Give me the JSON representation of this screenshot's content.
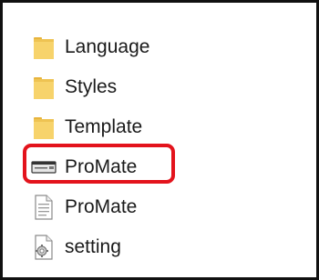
{
  "file_list": {
    "items": [
      {
        "label": "Language",
        "icon": "folder-icon"
      },
      {
        "label": "Styles",
        "icon": "folder-icon"
      },
      {
        "label": "Template",
        "icon": "folder-icon"
      },
      {
        "label": "ProMate",
        "icon": "application-icon"
      },
      {
        "label": "ProMate",
        "icon": "text-document-icon"
      },
      {
        "label": "setting",
        "icon": "settings-file-icon"
      }
    ]
  },
  "colors": {
    "folder": "#f7d36b",
    "folder_dark": "#e8b43c",
    "highlight": "#e3131c",
    "border": "#111111"
  }
}
